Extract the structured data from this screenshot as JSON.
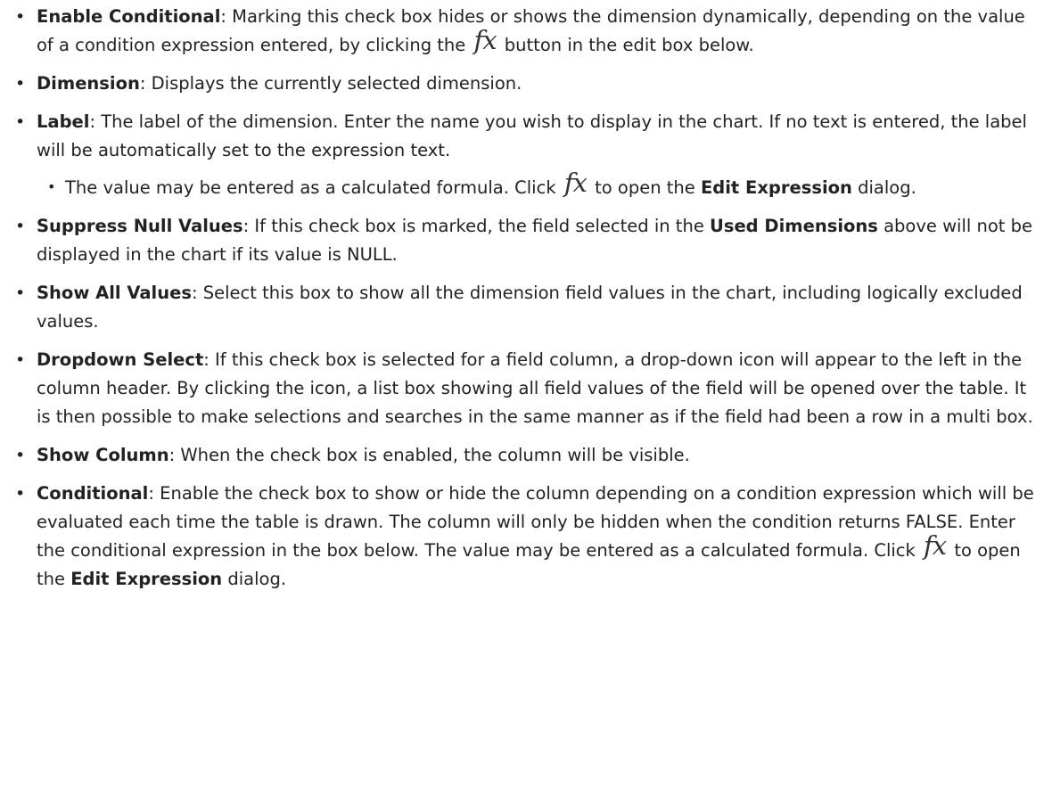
{
  "items": [
    {
      "term": "Enable Conditional",
      "text_a": ": Marking this check box hides or shows the dimension dynamically, depending on the value of a condition expression entered, by clicking the",
      "fx": "fx",
      "text_b": "button in the edit box below."
    },
    {
      "term": "Dimension",
      "text_a": ": Displays the currently selected dimension."
    },
    {
      "term": "Label",
      "text_a": ": The label of the dimension. Enter the name you wish to display in the chart. If no text is entered, the label will be automatically set to the expression text.",
      "sub": {
        "text_a": "The value may be entered as a calculated formula. Click",
        "fx": "fx",
        "text_b": "to open the",
        "bold": "Edit Expression",
        "text_c": "dialog."
      }
    },
    {
      "term": "Suppress Null Values",
      "text_a": ": If this check box is marked, the field selected in the",
      "bold": "Used Dimensions",
      "text_b": "above will not be displayed in the chart if its value is NULL."
    },
    {
      "term": "Show All Values",
      "text_a": ": Select this box to show all the dimension field values in the chart, including logically excluded values."
    },
    {
      "term": "Dropdown Select",
      "text_a": ": If this check box is selected for a field column, a drop-down icon will appear to the left in the column header. By clicking the icon, a list box showing all field values of the field will be opened over the table. It is then possible to make selections and searches in the same manner as if the field had been a row in a multi box."
    },
    {
      "term": "Show Column",
      "text_a": ": When the check box is enabled, the column will be visible."
    },
    {
      "term": "Conditional",
      "text_a": ": Enable the check box to show or hide the column depending on a condition expression which will be evaluated each time the table is drawn. The column will only be hidden when the condition returns FALSE. Enter the conditional expression in the box below. The value may be entered as a calculated formula. Click",
      "fx": "fx",
      "text_b": "to open the",
      "bold": "Edit Expression",
      "text_c": "dialog."
    }
  ]
}
